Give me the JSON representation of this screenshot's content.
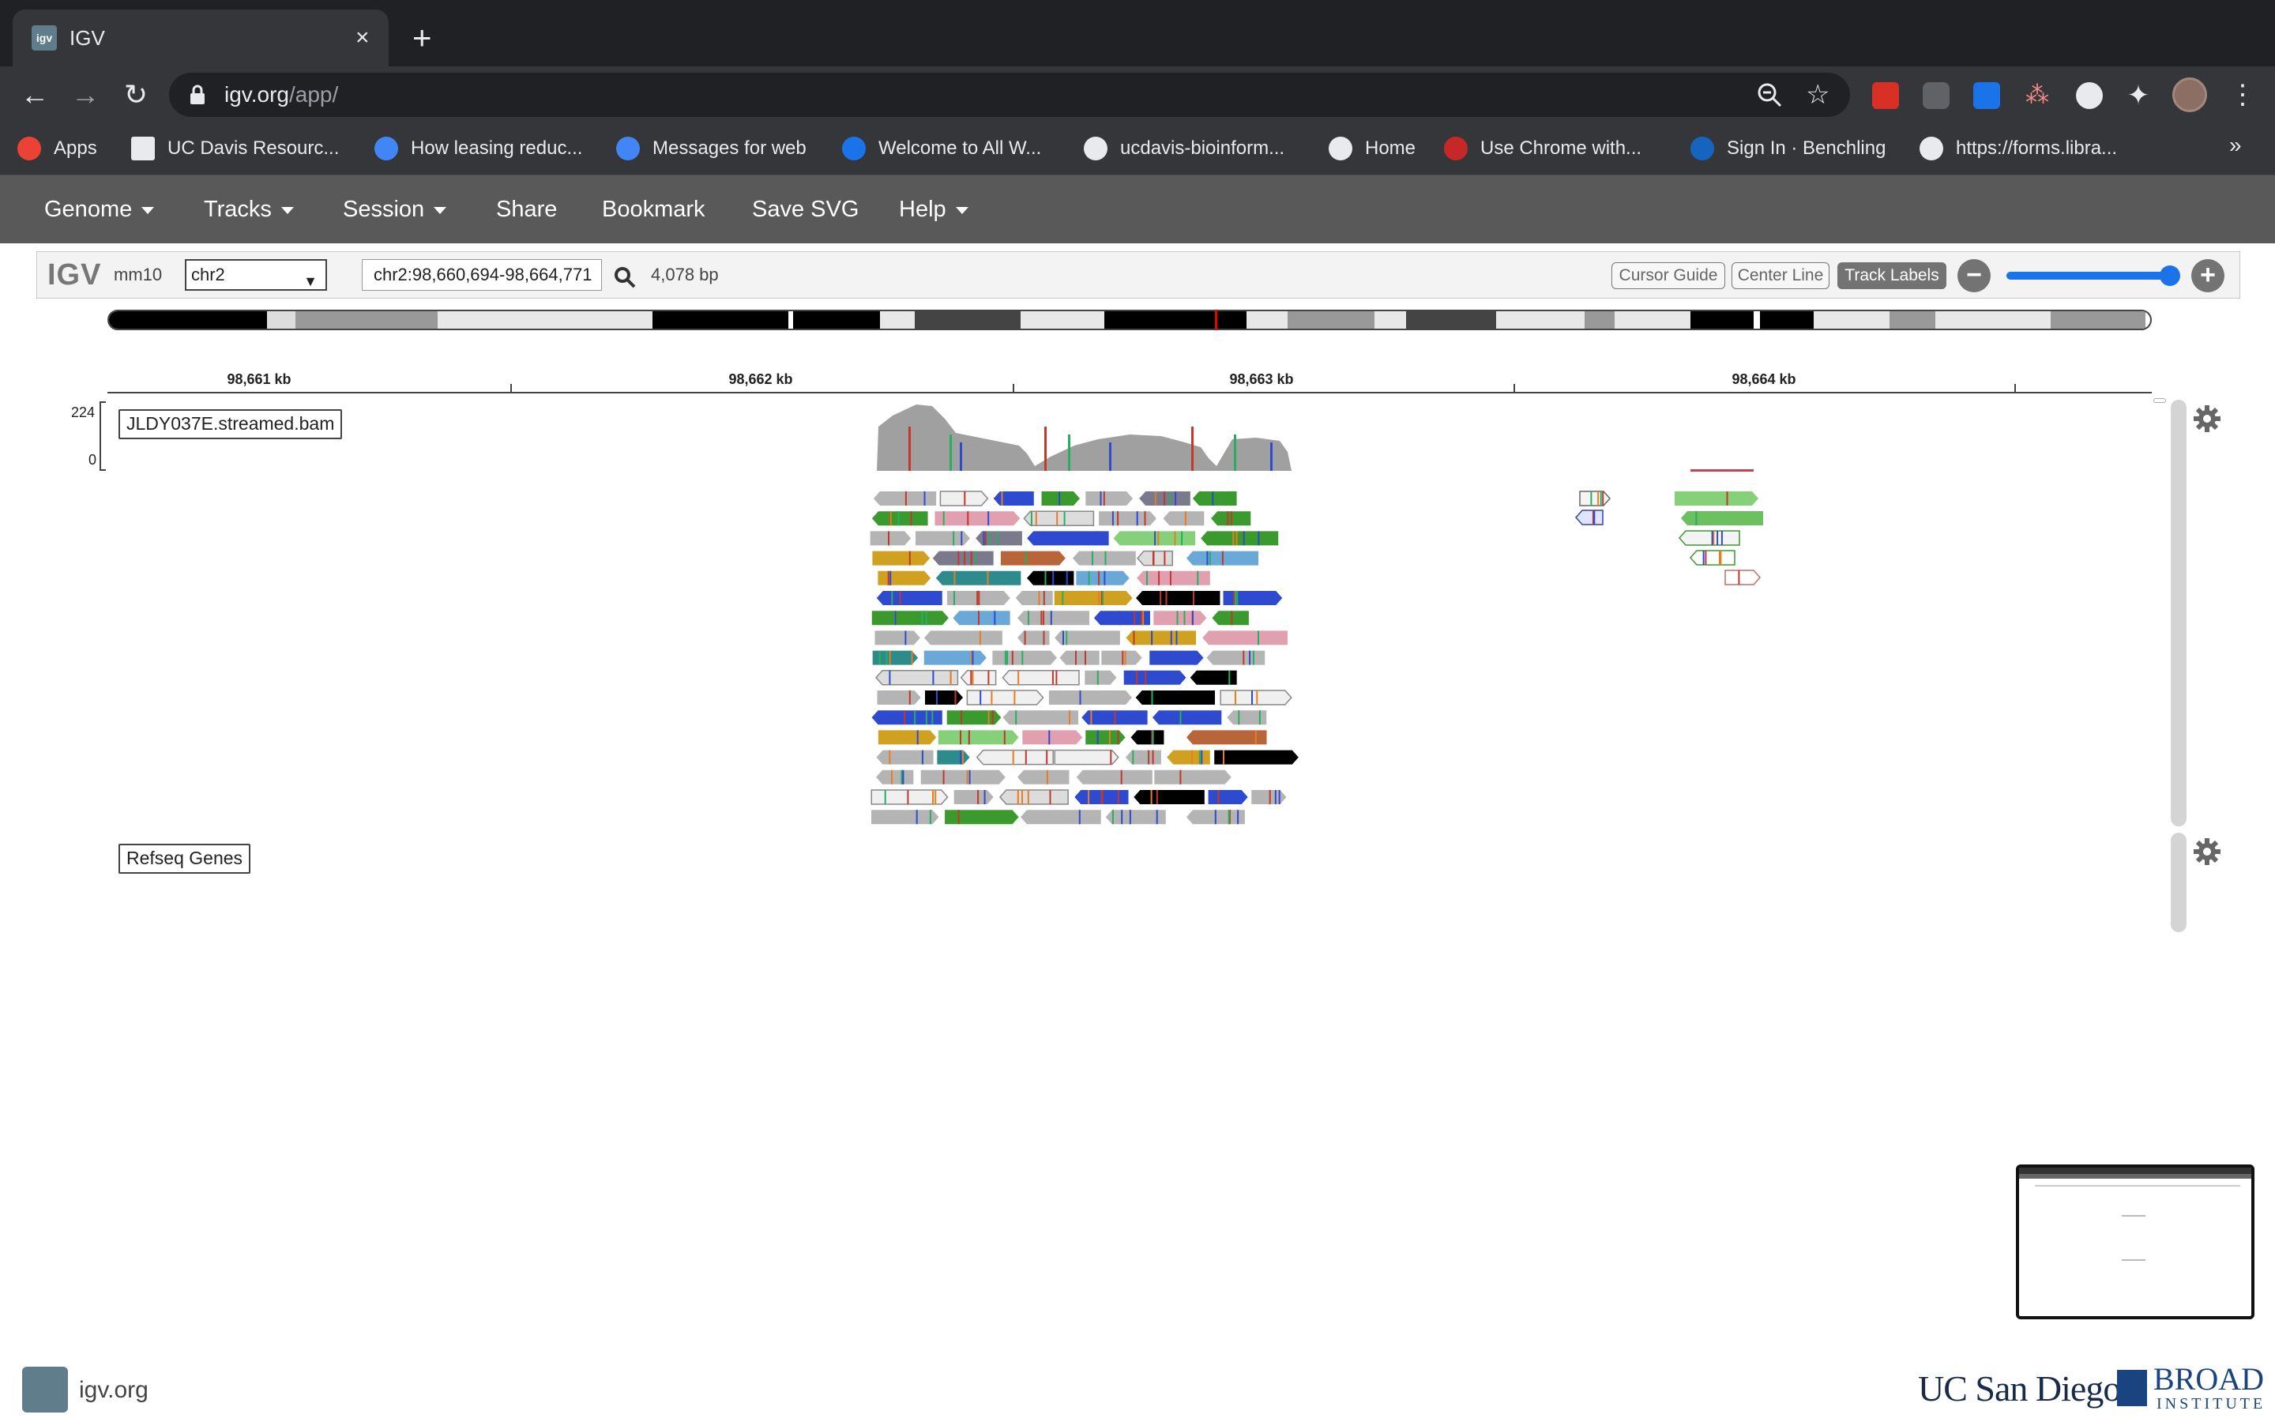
{
  "browser": {
    "tab_title": "IGV",
    "favicon_text": "igv",
    "url_host": "igv.org",
    "url_path": "/app/",
    "bookmarks": [
      {
        "label": "Apps",
        "color": "#ea4335"
      },
      {
        "label": "UC Davis Resourc...",
        "color": "#e8eaed"
      },
      {
        "label": "How leasing reduc...",
        "color": "#4285f4"
      },
      {
        "label": "Messages for web",
        "color": "#4285f4"
      },
      {
        "label": "Welcome to All W...",
        "color": "#1a73e8"
      },
      {
        "label": "ucdavis-bioinform...",
        "color": "#e8eaed"
      },
      {
        "label": "Home",
        "color": "#e8eaed"
      },
      {
        "label": "Use Chrome with...",
        "color": "#c62828"
      },
      {
        "label": "Sign In · Benchling",
        "color": "#1565c0"
      },
      {
        "label": "https://forms.libra...",
        "color": "#e8eaed"
      }
    ],
    "more_label": "»"
  },
  "menu": {
    "genome": "Genome",
    "tracks": "Tracks",
    "session": "Session",
    "share": "Share",
    "bookmark": "Bookmark",
    "save_svg": "Save SVG",
    "help": "Help"
  },
  "controls": {
    "logo": "IGV",
    "genome_id": "mm10",
    "chromosome": "chr2",
    "locus": "chr2:98,660,694-98,664,771",
    "width_bp": "4,078 bp",
    "cursor_guide": "Cursor Guide",
    "center_line": "Center Line",
    "track_labels": "Track Labels",
    "zoom_level": 0.95
  },
  "ruler": {
    "ticks": [
      "98,661 kb",
      "98,662 kb",
      "98,663 kb",
      "98,664 kb"
    ]
  },
  "tracks": {
    "alignment": {
      "name": "JLDY037E.streamed.bam",
      "coverage_max": "224",
      "coverage_min": "0"
    },
    "genes": {
      "name": "Refseq Genes"
    }
  },
  "footer": {
    "site": "igv.org",
    "ucsd": "UC San Diego",
    "broad_name": "BROAD",
    "broad_sub": "INSTITUTE"
  },
  "colors": {
    "nav_bg": "#595959",
    "read_grey": "#b4b4b4",
    "coverage": "#a0a0a0",
    "accent_blue": "#1a73e8"
  }
}
